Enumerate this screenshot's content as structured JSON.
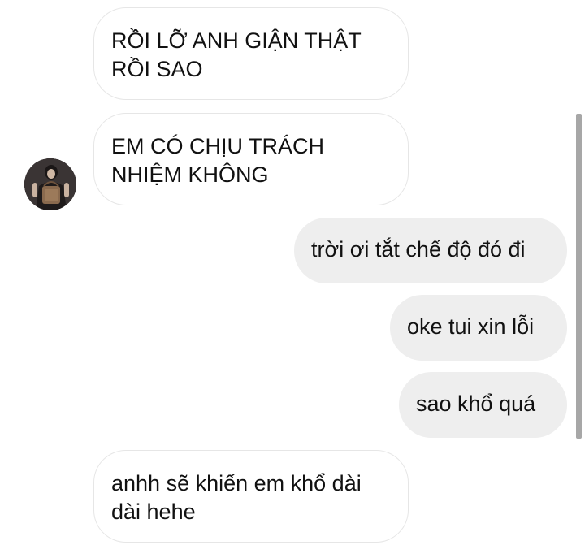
{
  "messages": [
    {
      "sender": "other",
      "text": "RỒI LỠ ANH GIẬN THẬT RỒI SAO"
    },
    {
      "sender": "other",
      "text": "EM CÓ CHỊU TRÁCH NHIỆM KHÔNG"
    },
    {
      "sender": "me",
      "text": "trời ơi tắt chế độ đó đi"
    },
    {
      "sender": "me",
      "text": "oke tui xin lỗi"
    },
    {
      "sender": "me",
      "text": "sao khổ quá"
    },
    {
      "sender": "other",
      "text": "anhh sẽ khiến em khổ dài dài hehe"
    }
  ],
  "colors": {
    "incoming_bubble_bg": "#ffffff",
    "incoming_bubble_border": "#e6e6e6",
    "outgoing_bubble_bg": "#eeeeee",
    "text": "#111111",
    "scrollbar": "#a7a7a7"
  }
}
